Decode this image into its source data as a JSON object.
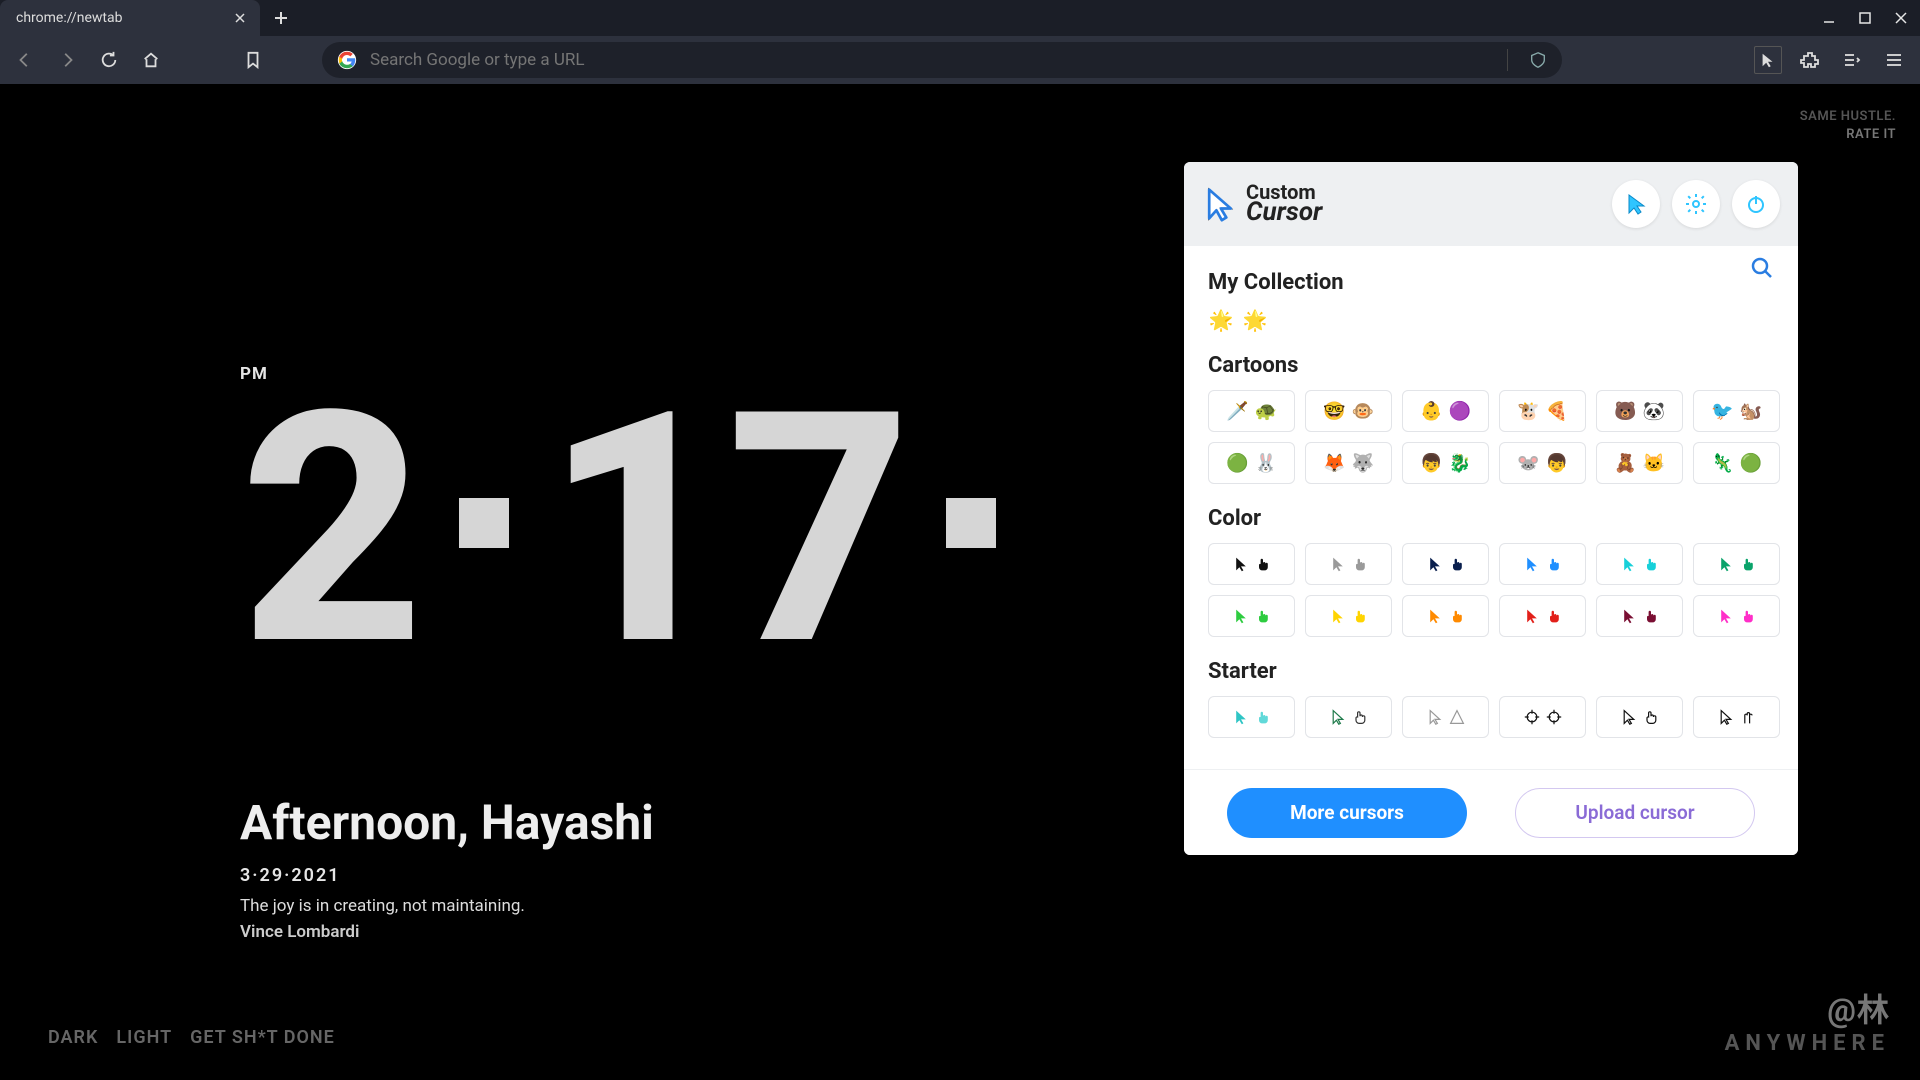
{
  "window": {
    "tab_title": "chrome://newtab",
    "omnibox_placeholder": "Search Google or type a URL"
  },
  "newtab": {
    "top_right_line1": "SAME HUSTLE.",
    "top_right_line2": "RATE IT",
    "ampm": "PM",
    "hours": "2",
    "minutes": "17",
    "greeting": "Afternoon, Hayashi",
    "date": "3·29·2021",
    "quote": "The joy is in creating, not maintaining.",
    "author": "Vince Lombardi",
    "themes": {
      "dark": "DARK",
      "light": "LIGHT",
      "gsd": "GET SH*T DONE"
    },
    "watermark_handle": "@林",
    "watermark_sub": "ANYWHERE"
  },
  "ext": {
    "logo_top": "Custom",
    "logo_bottom": "Cursor",
    "sections": {
      "my_collection_title": "My Collection",
      "cartoons_title": "Cartoons",
      "color_title": "Color",
      "starter_title": "Starter"
    },
    "my_collection": [
      "🌟",
      "🌟"
    ],
    "cartoons_row1": [
      [
        "🗡️",
        "🐢"
      ],
      [
        "🤓",
        "🐵"
      ],
      [
        "👶",
        "🟣"
      ],
      [
        "🐮",
        "🍕"
      ],
      [
        "🐻",
        "🐼"
      ],
      [
        "🐦",
        "🐿️"
      ]
    ],
    "cartoons_row2": [
      [
        "🟢",
        "🐰"
      ],
      [
        "🦊",
        "🐺"
      ],
      [
        "👦",
        "🐉"
      ],
      [
        "🐭",
        "👦"
      ],
      [
        "🧸",
        "🐱"
      ],
      [
        "🦎",
        "🟢"
      ]
    ],
    "colors_row1": [
      "#111111",
      "#9a9a9a",
      "#0a1f4d",
      "#1f8fff",
      "#17d0d9",
      "#0aa36a"
    ],
    "colors_row2": [
      "#2ecc40",
      "#ffd400",
      "#ff8a00",
      "#e2201a",
      "#7a0f33",
      "#ff2ec8"
    ],
    "buttons": {
      "more": "More cursors",
      "upload": "Upload cursor"
    }
  }
}
